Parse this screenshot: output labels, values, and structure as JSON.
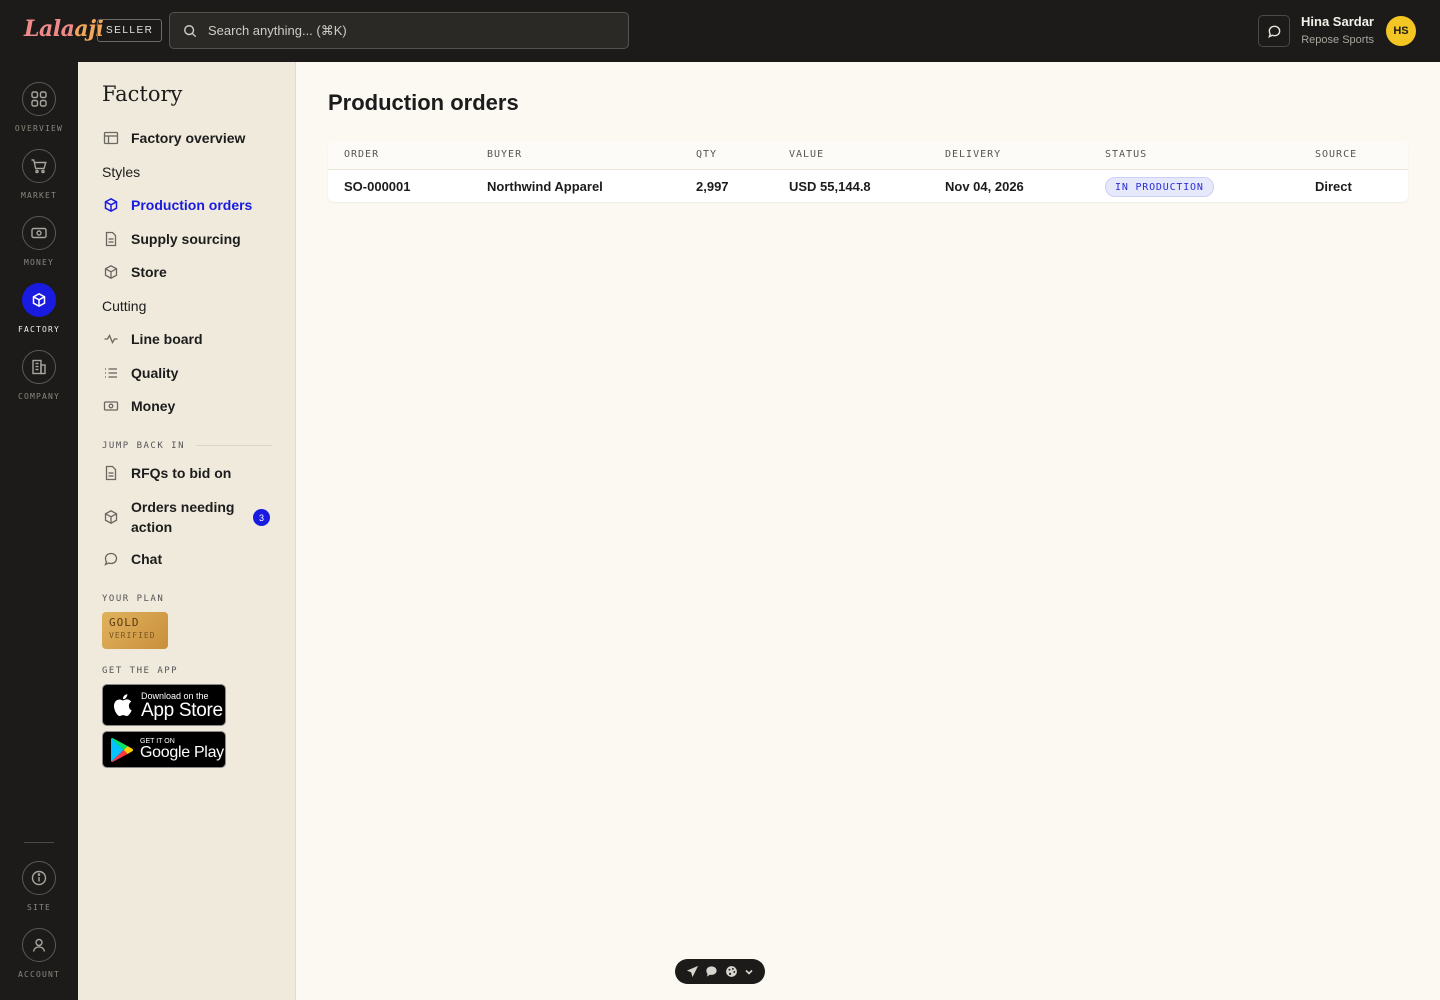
{
  "app": {
    "logo": "Lalaaji",
    "role_badge": "SELLER"
  },
  "search": {
    "placeholder": "Search anything... (⌘K)"
  },
  "user": {
    "name": "Hina Sardar",
    "org": "Repose Sports",
    "initials": "HS"
  },
  "rail": {
    "items": [
      {
        "label": "OVERVIEW",
        "icon": "grid-icon"
      },
      {
        "label": "MARKET",
        "icon": "cart-icon"
      },
      {
        "label": "MONEY",
        "icon": "banknote-icon"
      },
      {
        "label": "FACTORY",
        "icon": "cube-icon",
        "active": true
      },
      {
        "label": "COMPANY",
        "icon": "building-icon"
      }
    ],
    "bottom": [
      {
        "label": "SITE",
        "icon": "info-icon"
      },
      {
        "label": "ACCOUNT",
        "icon": "user-icon"
      }
    ]
  },
  "sidebar": {
    "title": "Factory",
    "factory_overview": "Factory overview",
    "styles_heading": "Styles",
    "production_orders": "Production orders",
    "supply_sourcing": "Supply sourcing",
    "store": "Store",
    "cutting_heading": "Cutting",
    "line_board": "Line board",
    "quality": "Quality",
    "money": "Money",
    "jump_back_in": "JUMP BACK IN",
    "rfqs": "RFQs to bid on",
    "orders_needing_action_1": "Orders needing",
    "orders_needing_action_2": "action",
    "orders_needing_action_count": "3",
    "chat": "Chat",
    "your_plan": "YOUR PLAN",
    "plan_name": "GOLD",
    "plan_status": "VERIFIED",
    "get_the_app": "GET THE APP",
    "app_store_small": "Download on the",
    "app_store_large": "App Store",
    "google_play_small": "GET IT ON",
    "google_play_large": "Google Play"
  },
  "main": {
    "title": "Production orders",
    "columns": [
      "ORDER",
      "BUYER",
      "QTY",
      "VALUE",
      "DELIVERY",
      "STATUS",
      "SOURCE"
    ],
    "rows": [
      {
        "order": "SO-000001",
        "buyer": "Northwind Apparel",
        "qty": "2,997",
        "value": "USD 55,144.8",
        "delivery": "Nov 04, 2026",
        "status": "IN PRODUCTION",
        "source": "Direct"
      }
    ]
  },
  "colors": {
    "accent": "#1a1be0",
    "dark": "#1c1b19",
    "sidebar_bg": "#efeadc",
    "main_bg": "#fcf9f3",
    "avatar": "#f3c623"
  }
}
